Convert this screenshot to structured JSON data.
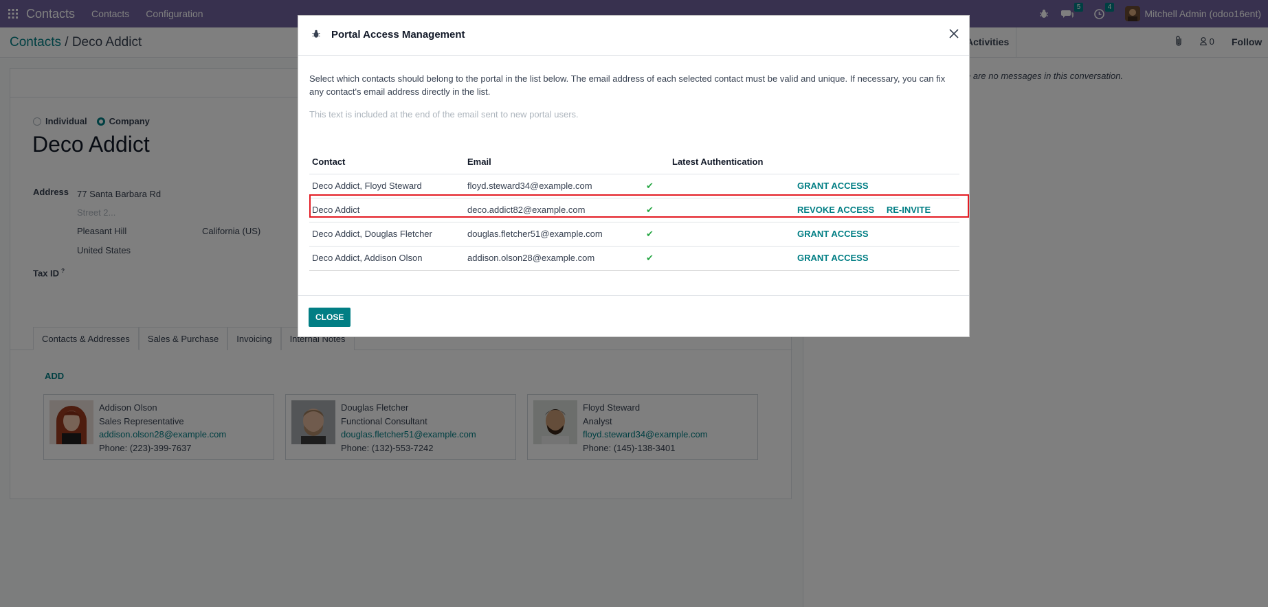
{
  "navbar": {
    "app_name": "Contacts",
    "menu": [
      "Contacts",
      "Configuration"
    ],
    "messages_count": "5",
    "activities_count": "4",
    "user": "Mitchell Admin (odoo16ent)"
  },
  "breadcrumb": {
    "parent": "Contacts",
    "separator": "/",
    "current": "Deco Addict"
  },
  "chatter": {
    "activities_label": "Activities",
    "followers_count": "0",
    "follow_label": "Follow",
    "empty_message": "e are no messages in this conversation."
  },
  "form": {
    "individual_label": "Individual",
    "company_label": "Company",
    "name": "Deco Addict",
    "address_label": "Address",
    "street": "77 Santa Barbara Rd",
    "street2_placeholder": "Street 2...",
    "city": "Pleasant Hill",
    "state": "California (US)",
    "country": "United States",
    "tax_label": "Tax ID",
    "tax_help": "?",
    "tabs": [
      "Contacts & Addresses",
      "Sales & Purchase",
      "Invoicing",
      "Internal Notes"
    ],
    "add_label": "ADD",
    "contacts": [
      {
        "name": "Addison Olson",
        "role": "Sales Representative",
        "email": "addison.olson28@example.com",
        "phone": "Phone: (223)-399-7637"
      },
      {
        "name": "Douglas Fletcher",
        "role": "Functional Consultant",
        "email": "douglas.fletcher51@example.com",
        "phone": "Phone: (132)-553-7242"
      },
      {
        "name": "Floyd Steward",
        "role": "Analyst",
        "email": "floyd.steward34@example.com",
        "phone": "Phone: (145)-138-3401"
      }
    ]
  },
  "modal": {
    "title": "Portal Access Management",
    "intro": "Select which contacts should belong to the portal in the list below. The email address of each selected contact must be valid and unique. If necessary, you can fix any contact's email address directly in the list.",
    "welcome_placeholder": "This text is included at the end of the email sent to new portal users.",
    "columns": [
      "Contact",
      "Email",
      "Latest Authentication"
    ],
    "rows": [
      {
        "contact": "Deco Addict, Floyd Steward",
        "email": "floyd.steward34@example.com",
        "check": "✔",
        "auth": "",
        "action1": "GRANT ACCESS",
        "action2": ""
      },
      {
        "contact": "Deco Addict",
        "email": "deco.addict82@example.com",
        "check": "✔",
        "auth": "",
        "action1": "REVOKE ACCESS",
        "action2": "RE-INVITE"
      },
      {
        "contact": "Deco Addict, Douglas Fletcher",
        "email": "douglas.fletcher51@example.com",
        "check": "✔",
        "auth": "",
        "action1": "GRANT ACCESS",
        "action2": ""
      },
      {
        "contact": "Deco Addict, Addison Olson",
        "email": "addison.olson28@example.com",
        "check": "✔",
        "auth": "",
        "action1": "GRANT ACCESS",
        "action2": ""
      }
    ],
    "close_label": "CLOSE"
  },
  "colors": {
    "navbar": "#71639e",
    "accent": "#017e84",
    "highlight": "#e31b23",
    "check": "#28a745"
  }
}
